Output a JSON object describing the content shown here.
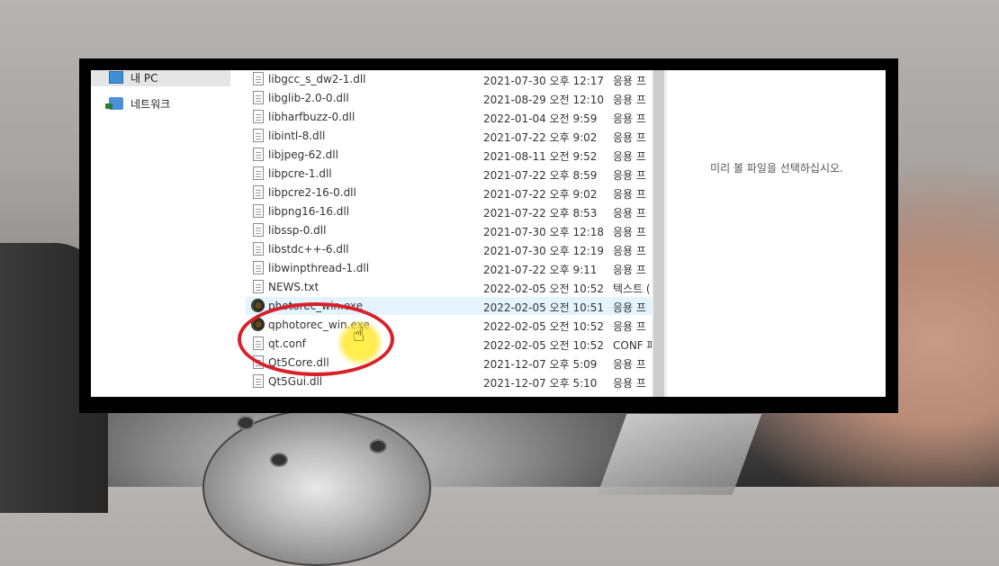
{
  "navigation": {
    "items": [
      {
        "label": "내 PC",
        "icon": "pc-icon"
      },
      {
        "label": "네트워크",
        "icon": "network-icon"
      }
    ]
  },
  "files": [
    {
      "name": "libgcc_s_dw2-1.dll",
      "date": "2021-07-30 오후 12:17",
      "type": "응용 프"
    },
    {
      "name": "libglib-2.0-0.dll",
      "date": "2021-08-29 오전 12:10",
      "type": "응용 프"
    },
    {
      "name": "libharfbuzz-0.dll",
      "date": "2022-01-04 오전 9:59",
      "type": "응용 프"
    },
    {
      "name": "libintl-8.dll",
      "date": "2021-07-22 오후 9:02",
      "type": "응용 프"
    },
    {
      "name": "libjpeg-62.dll",
      "date": "2021-08-11 오전 9:52",
      "type": "응용 프"
    },
    {
      "name": "libpcre-1.dll",
      "date": "2021-07-22 오후 8:59",
      "type": "응용 프"
    },
    {
      "name": "libpcre2-16-0.dll",
      "date": "2021-07-22 오후 9:02",
      "type": "응용 프"
    },
    {
      "name": "libpng16-16.dll",
      "date": "2021-07-22 오후 8:53",
      "type": "응용 프"
    },
    {
      "name": "libssp-0.dll",
      "date": "2021-07-30 오후 12:18",
      "type": "응용 프"
    },
    {
      "name": "libstdc++-6.dll",
      "date": "2021-07-30 오후 12:19",
      "type": "응용 프"
    },
    {
      "name": "libwinpthread-1.dll",
      "date": "2021-07-22 오후 9:11",
      "type": "응용 프"
    },
    {
      "name": "NEWS.txt",
      "date": "2022-02-05 오전 10:52",
      "type": "텍스트 ("
    },
    {
      "name": "photorec_win.exe",
      "date": "2022-02-05 오전 10:51",
      "type": "응용 프"
    },
    {
      "name": "qphotorec_win.exe",
      "date": "2022-02-05 오전 10:52",
      "type": "응용 프"
    },
    {
      "name": "qt.conf",
      "date": "2022-02-05 오전 10:52",
      "type": "CONF 파"
    },
    {
      "name": "Qt5Core.dll",
      "date": "2021-12-07 오후 5:09",
      "type": "응용 프"
    },
    {
      "name": "Qt5Gui.dll",
      "date": "2021-12-07 오후 5:10",
      "type": "응용 프"
    }
  ],
  "preview": {
    "message": "미리 볼 파일을 선택하십시오."
  },
  "colors": {
    "annotation_circle": "#d8202a",
    "cursor_highlight": "#ffe628",
    "hover_row": "#e5f3ff"
  }
}
